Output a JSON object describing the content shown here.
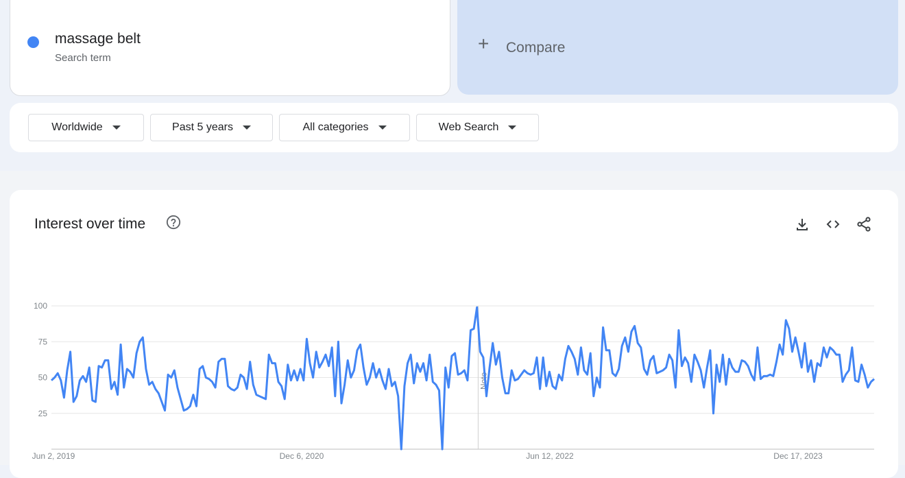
{
  "search_term": {
    "title": "massage belt",
    "subtitle": "Search term",
    "color": "#4285f4"
  },
  "compare": {
    "plus": "+",
    "label": "Compare"
  },
  "filters": [
    {
      "label": "Worldwide"
    },
    {
      "label": "Past 5 years"
    },
    {
      "label": "All categories"
    },
    {
      "label": "Web Search"
    }
  ],
  "chart_header": {
    "title": "Interest over time",
    "icons": [
      "help-icon",
      "download-icon",
      "embed-icon",
      "share-icon"
    ]
  },
  "chart_data": {
    "type": "line",
    "ylim": [
      0,
      100
    ],
    "yticks": [
      25,
      50,
      75,
      100
    ],
    "grid": true,
    "x_tick_labels": [
      "Jun 2, 2019",
      "Dec 6, 2020",
      "Jun 12, 2022",
      "Dec 17, 2023"
    ],
    "note_label": "Note",
    "note_date": "2022-01-01",
    "start_date": "2019-06-02",
    "end_date": "2024-05-26",
    "line_color": "#4285f4",
    "series": [
      {
        "values": [
          48,
          50,
          53,
          48,
          36,
          55,
          68,
          33,
          37,
          48,
          51,
          47,
          57,
          34,
          33,
          58,
          57,
          62,
          62,
          42,
          47,
          38,
          73,
          43,
          56,
          54,
          50,
          67,
          75,
          78,
          56,
          45,
          47,
          42,
          39,
          33,
          27,
          52,
          50,
          55,
          43,
          35,
          27,
          28,
          30,
          38,
          30,
          56,
          58,
          50,
          49,
          47,
          43,
          61,
          63,
          63,
          44,
          42,
          41,
          43,
          52,
          50,
          42,
          61,
          45,
          38,
          37,
          36,
          35,
          66,
          60,
          60,
          47,
          44,
          35,
          59,
          48,
          55,
          48,
          56,
          48,
          77,
          60,
          50,
          68,
          57,
          61,
          66,
          58,
          71,
          37,
          75,
          32,
          45,
          62,
          50,
          55,
          69,
          73,
          57,
          45,
          50,
          60,
          50,
          56,
          48,
          42,
          56,
          44,
          47,
          37,
          0,
          44,
          60,
          66,
          46,
          60,
          54,
          60,
          48,
          66,
          47,
          45,
          41,
          0,
          57,
          43,
          65,
          67,
          52,
          53,
          55,
          48,
          83,
          84,
          99,
          68,
          64,
          37,
          57,
          74,
          59,
          68,
          50,
          39,
          39,
          55,
          48,
          49,
          52,
          55,
          53,
          52,
          53,
          64,
          42,
          64,
          44,
          54,
          44,
          42,
          52,
          48,
          63,
          72,
          68,
          63,
          52,
          71,
          55,
          52,
          67,
          37,
          50,
          43,
          85,
          69,
          69,
          53,
          51,
          56,
          72,
          78,
          68,
          82,
          86,
          74,
          71,
          56,
          52,
          62,
          65,
          53,
          54,
          55,
          57,
          66,
          62,
          43,
          83,
          58,
          64,
          60,
          47,
          66,
          61,
          55,
          43,
          57,
          69,
          25,
          59,
          47,
          66,
          45,
          63,
          57,
          54,
          54,
          62,
          61,
          58,
          52,
          48,
          71,
          49,
          51,
          51,
          52,
          51,
          61,
          73,
          66,
          90,
          84,
          68,
          78,
          68,
          57,
          74,
          54,
          62,
          47,
          60,
          58,
          71,
          64,
          71,
          69,
          66,
          66,
          47,
          52,
          55,
          71,
          48,
          47,
          59,
          52,
          43,
          47,
          49
        ]
      }
    ]
  }
}
